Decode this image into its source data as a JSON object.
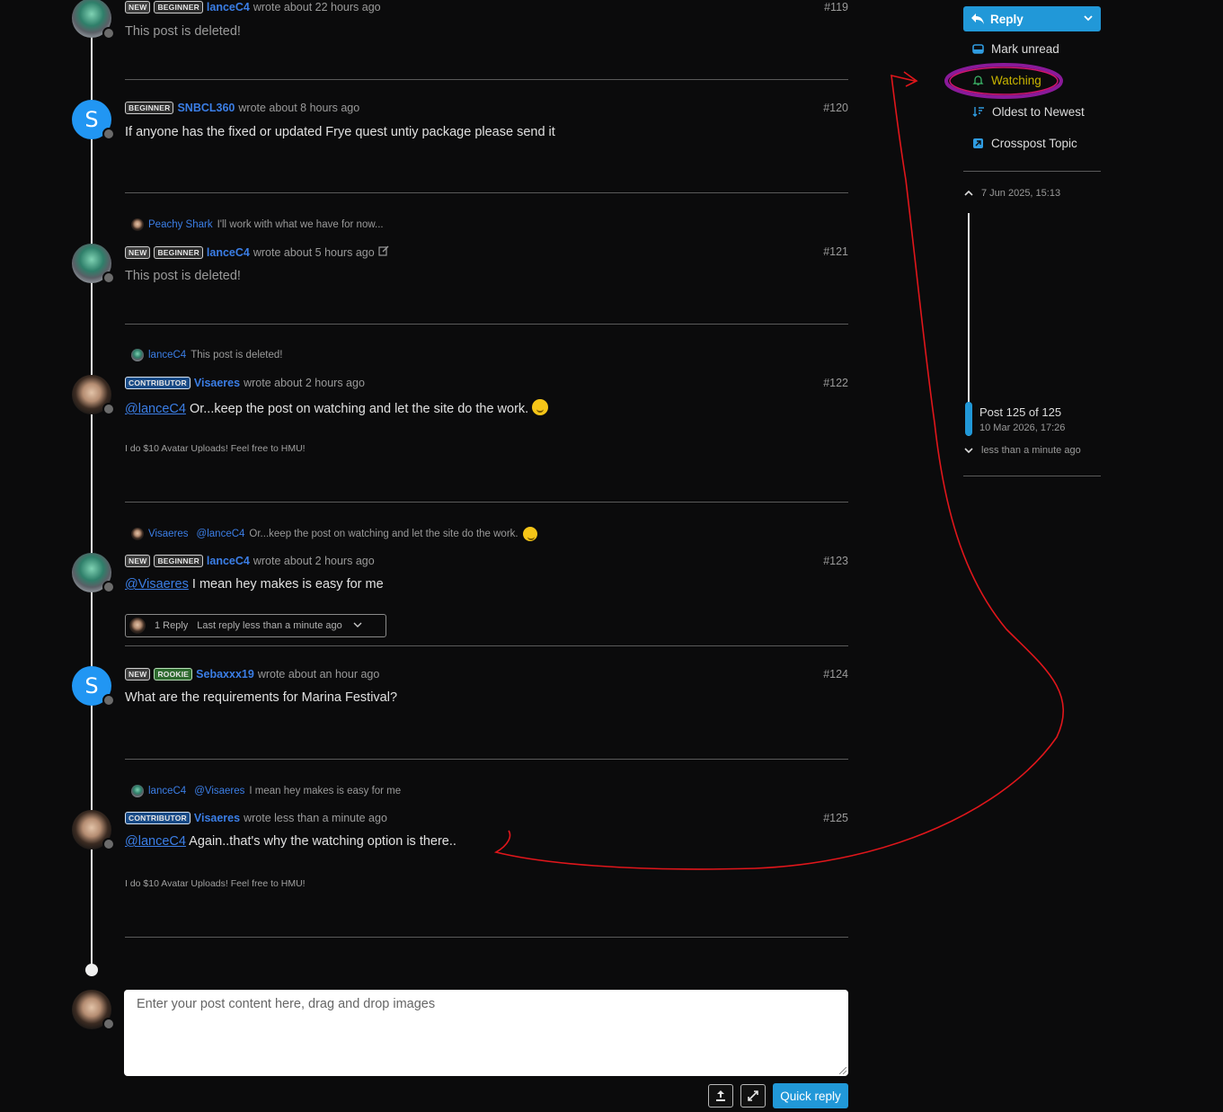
{
  "posts": [
    {
      "id": "119",
      "badges": [
        "NEW",
        "BEGINNER"
      ],
      "user": "lanceC4",
      "time": "wrote about 22 hours ago",
      "num": "#119",
      "body": "This post is deleted!"
    },
    {
      "id": "120",
      "badges": [
        "BEGINNER"
      ],
      "user": "SNBCL360",
      "time": "wrote about 8 hours ago",
      "num": "#120",
      "body": "If anyone has the fixed or updated Frye quest untiy package please send it",
      "avatar_letter": "S"
    },
    {
      "id": "121",
      "parent_user": "Peachy Shark",
      "parent_text": "I'll work with what we have for now...",
      "badges": [
        "NEW",
        "BEGINNER"
      ],
      "user": "lanceC4",
      "time": "wrote about 5 hours ago",
      "num": "#121",
      "body": "This post is deleted!"
    },
    {
      "id": "122",
      "parent_user": "lanceC4",
      "parent_text": "This post is deleted!",
      "badges": [
        "CONTRIBUTOR"
      ],
      "user": "Visaeres",
      "time": "wrote about 2 hours ago",
      "num": "#122",
      "mention": "@lanceC4",
      "body": "Or...keep the post on watching and let the site do the work.",
      "signature": "I do $10 Avatar Uploads! Feel free to HMU!"
    },
    {
      "id": "123",
      "parent_user": "Visaeres",
      "parent_mention": "@lanceC4",
      "parent_text": "Or...keep the post on watching and let the site do the work.",
      "badges": [
        "NEW",
        "BEGINNER"
      ],
      "user": "lanceC4",
      "time": "wrote about 2 hours ago",
      "num": "#123",
      "mention": "@Visaeres",
      "body": "I mean hey makes is easy for me",
      "replies": "1 Reply",
      "last_reply": "Last reply less than a minute ago"
    },
    {
      "id": "124",
      "badges": [
        "NEW",
        "ROOKIE"
      ],
      "user": "Sebaxxx19",
      "time": "wrote about an hour ago",
      "num": "#124",
      "body": "What are the requirements for Marina Festival?",
      "avatar_letter": "S"
    },
    {
      "id": "125",
      "parent_user": "lanceC4",
      "parent_mention": "@Visaeres",
      "parent_text": "I mean hey makes is easy for me",
      "badges": [
        "CONTRIBUTOR"
      ],
      "user": "Visaeres",
      "time": "wrote less than a minute ago",
      "num": "#125",
      "mention": "@lanceC4",
      "body": "Again..that's why the watching option is there..",
      "signature": "I do $10 Avatar Uploads! Feel free to HMU!"
    }
  ],
  "composer": {
    "placeholder": "Enter your post content here, drag and drop images",
    "quick_reply": "Quick reply"
  },
  "sidebar": {
    "reply": "Reply",
    "mark_unread": "Mark unread",
    "watching": "Watching",
    "sort": "Oldest to Newest",
    "crosspost": "Crosspost Topic",
    "timeline_start": "7 Jun 2025, 15:13",
    "post_position": "Post 125 of 125",
    "post_date": "10 Mar 2026, 17:26",
    "timeline_end": "less than a minute ago"
  },
  "colors": {
    "accent": "#2198d8",
    "username": "#3b7ee6",
    "watching": "#c8b400",
    "annotation_red": "#e0161b",
    "annotation_purple": "#8a1a9a"
  }
}
